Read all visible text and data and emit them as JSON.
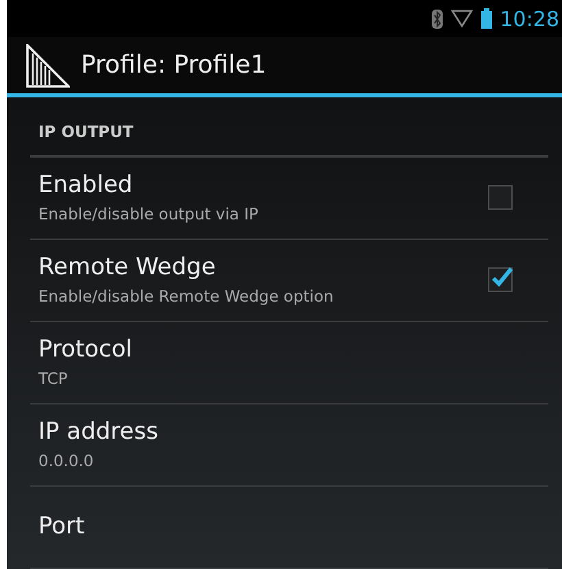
{
  "status_bar": {
    "time": "10:28"
  },
  "action_bar": {
    "title": "Profile: Profile1"
  },
  "section": {
    "title": "IP OUTPUT"
  },
  "preferences": [
    {
      "kind": "checkbox",
      "title": "Enabled",
      "summary": "Enable/disable output via IP",
      "checked": false
    },
    {
      "kind": "checkbox",
      "title": "Remote Wedge",
      "summary": "Enable/disable Remote Wedge option",
      "checked": true
    },
    {
      "kind": "value",
      "title": "Protocol",
      "summary": "TCP"
    },
    {
      "kind": "value",
      "title": "IP address",
      "summary": "0.0.0.0"
    },
    {
      "kind": "value",
      "title": "Port"
    }
  ]
}
